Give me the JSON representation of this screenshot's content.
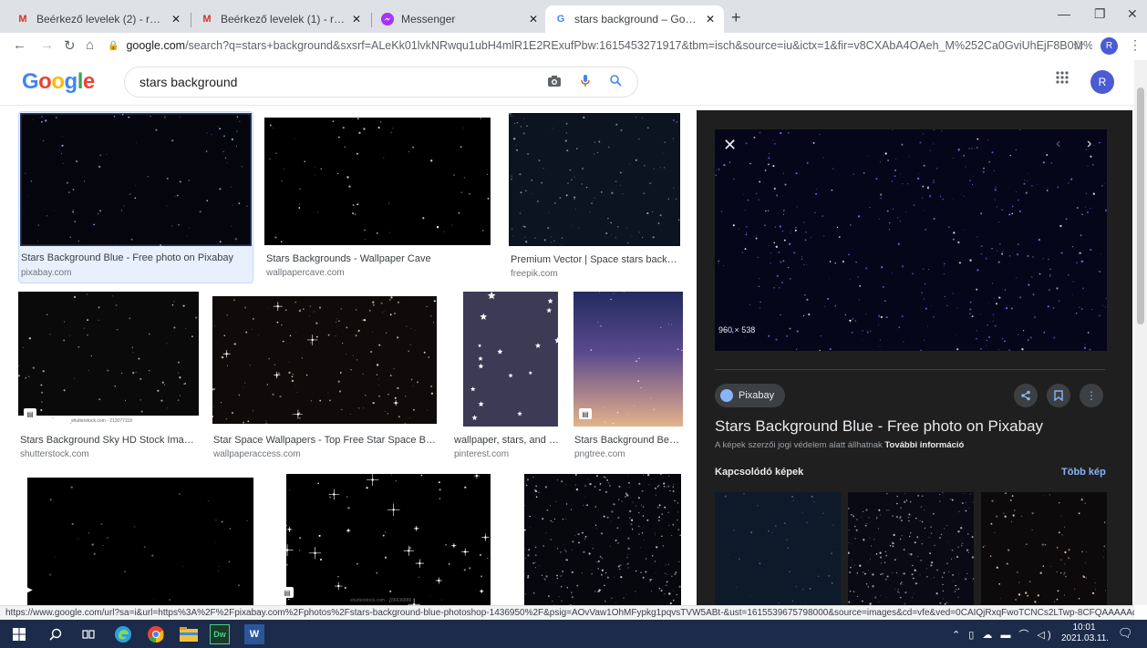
{
  "browser": {
    "tabs": [
      {
        "title": "Beérkező levelek (2) - robertdene",
        "favicon": "gmail-icon",
        "active": false
      },
      {
        "title": "Beérkező levelek (1) - rakosrober",
        "favicon": "gmail-icon",
        "active": false
      },
      {
        "title": "Messenger",
        "favicon": "messenger-icon",
        "active": false
      },
      {
        "title": "stars background – Google Keres",
        "favicon": "google-icon",
        "active": true
      }
    ],
    "url_domain": "google.com",
    "url_rest": "/search?q=stars+background&sxsrf=ALeKk01lvkNRwqu1ubH4mlR1E2RExufPbw:1615453271917&tbm=isch&source=iu&ictx=1&fir=v8CXAbA4OAeh_M%252Ca0GviUhEjF8B0M%252C_&ve...",
    "profile_initial": "R"
  },
  "google": {
    "logo": "Google",
    "query": "stars background",
    "profile_initial": "R"
  },
  "results": [
    {
      "caption": "Stars Background Blue - Free photo on Pixabay",
      "source": "pixabay.com"
    },
    {
      "caption": "Stars Backgrounds - Wallpaper Cave",
      "source": "wallpapercave.com"
    },
    {
      "caption": "Premium Vector | Space stars backgrou...",
      "source": "freepik.com"
    },
    {
      "caption": "Stars Background Sky HD Stock Images ...",
      "source": "shutterstock.com",
      "watermark": "shutterstock.com · 213077119"
    },
    {
      "caption": "Star Space Wallpapers - Top Free Star Space Backg...",
      "source": "wallpaperaccess.com"
    },
    {
      "caption": "wallpaper, stars, and b...",
      "source": "pinterest.com"
    },
    {
      "caption": "Stars Background Beau...",
      "source": "pngtree.com"
    },
    {
      "caption": "",
      "source": ""
    },
    {
      "caption": "",
      "source": "",
      "watermark": "shutterstock.com · 786636886"
    },
    {
      "caption": "",
      "source": ""
    }
  ],
  "preview": {
    "dimensions": "960 × 538",
    "source_name": "Pixabay",
    "title": "Stars Background Blue - Free photo on Pixabay",
    "copyright_note": "A képek szerzői jogi védelem alatt állhatnak",
    "more_info_link": "További információ",
    "related_label": "Kapcsolódó képek",
    "more_images_link": "Több kép"
  },
  "status_url": "https://www.google.com/url?sa=i&url=https%3A%2F%2Fpixabay.com%2Fphotos%2Fstars-background-blue-photoshop-1436950%2F&psig=AOvVaw1OhMFypkg1pqvsTVW5ABt-&ust=1615539675798000&source=images&cd=vfe&ved=0CAIQjRxqFwoTCNCs2LTwp-8CFQAAAAAdA...",
  "taskbar": {
    "time": "10:01",
    "date": "2021.03.11.",
    "apps": [
      "windows-start-icon",
      "search-icon",
      "task-view-icon",
      "edge-icon",
      "chrome-icon",
      "file-explorer-icon",
      "dreamweaver-icon",
      "word-icon"
    ]
  },
  "colors": {
    "tab_strip": "#dee1e6",
    "preview_bg": "#1f1f1f",
    "link_blue": "#8ab4f8",
    "taskbar": "#1c2b4a"
  }
}
